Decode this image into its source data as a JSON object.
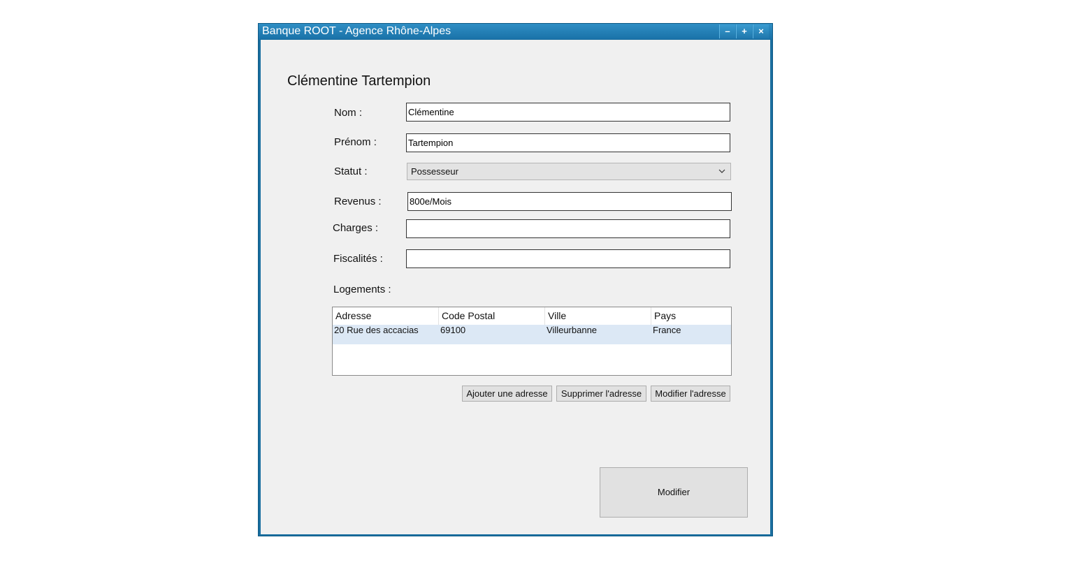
{
  "window": {
    "title": "Banque ROOT - Agence Rhône-Alpes",
    "minimize_glyph": "–",
    "maximize_glyph": "+",
    "close_glyph": "×"
  },
  "form": {
    "heading": "Clémentine Tartempion",
    "nom": {
      "label": "Nom :",
      "value": "Clémentine"
    },
    "prenom": {
      "label": "Prénom :",
      "value": "Tartempion"
    },
    "statut": {
      "label": "Statut :",
      "value": "Possesseur"
    },
    "revenus": {
      "label": "Revenus :",
      "value": "800e/Mois"
    },
    "charges": {
      "label": "Charges :",
      "value": ""
    },
    "fiscalites": {
      "label": "Fiscalités :",
      "value": ""
    },
    "logements_label": "Logements :"
  },
  "logements": {
    "columns": [
      "Adresse",
      "Code Postal",
      "Ville",
      "Pays"
    ],
    "rows": [
      [
        "20 Rue des accacias",
        "69100",
        "Villeurbanne",
        "France"
      ]
    ]
  },
  "buttons": {
    "add_address": "Ajouter une adresse",
    "delete_address": "Supprimer l'adresse",
    "edit_address": "Modifier l'adresse",
    "modify": "Modifier"
  },
  "colors": {
    "titlebar": "#1a72a8",
    "client_bg": "#f0f0f0",
    "selected_row": "#dce8f5"
  }
}
